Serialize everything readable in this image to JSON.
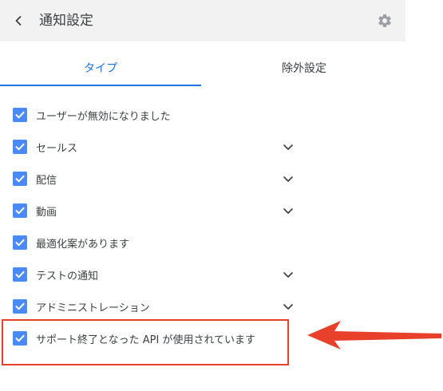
{
  "header": {
    "back_icon": "chevron-left-icon",
    "title": "通知設定",
    "settings_icon": "gear-icon"
  },
  "tabs": [
    {
      "label": "タイプ",
      "selected": true
    },
    {
      "label": "除外設定",
      "selected": false
    }
  ],
  "notifications": [
    {
      "label": "ユーザーが無効になりました",
      "checked": true,
      "expandable": false
    },
    {
      "label": "セールス",
      "checked": true,
      "expandable": true
    },
    {
      "label": "配信",
      "checked": true,
      "expandable": true
    },
    {
      "label": "動画",
      "checked": true,
      "expandable": true
    },
    {
      "label": "最適化案があります",
      "checked": true,
      "expandable": false
    },
    {
      "label": "テストの通知",
      "checked": true,
      "expandable": true
    },
    {
      "label": "アドミニストレーション",
      "checked": true,
      "expandable": true
    },
    {
      "label": "サポート終了となった API が使用されています",
      "checked": true,
      "expandable": false
    }
  ],
  "colors": {
    "accent": "#1a73e8",
    "checkbox": "#4a8af4",
    "annotation": "#e8402a"
  }
}
